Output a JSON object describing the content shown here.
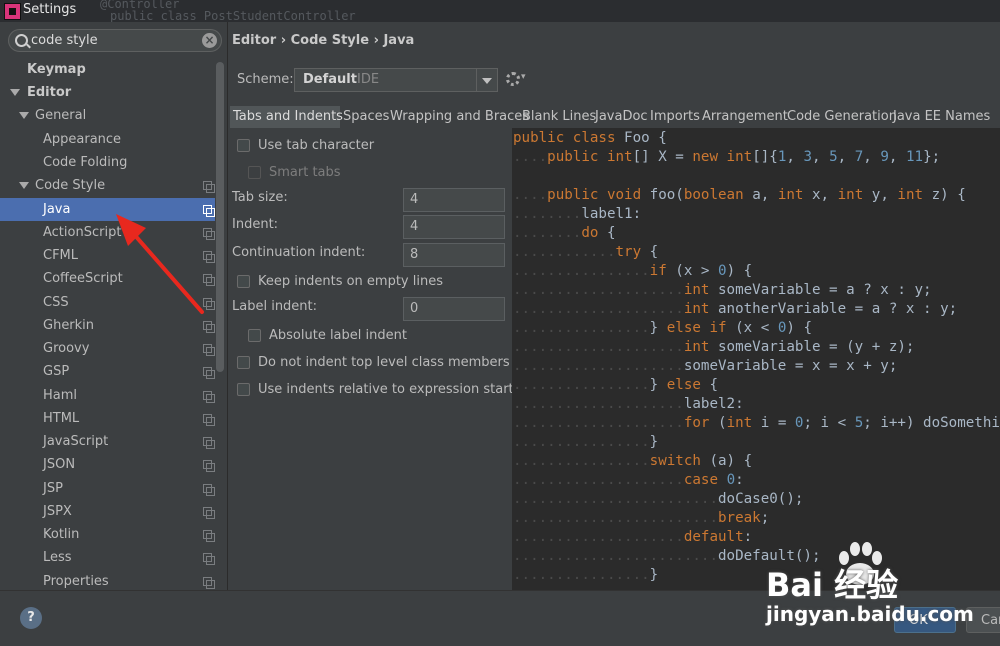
{
  "window": {
    "title": "Settings",
    "background_code": [
      "@Controller",
      "public class PostStudentController"
    ]
  },
  "search": {
    "value": "code style"
  },
  "tree": {
    "keymap": "Keymap",
    "editor": "Editor",
    "general": "General",
    "appearance": "Appearance",
    "code_folding": "Code Folding",
    "code_style": "Code Style",
    "languages": [
      "Java",
      "ActionScript",
      "CFML",
      "CoffeeScript",
      "CSS",
      "Gherkin",
      "Groovy",
      "GSP",
      "Haml",
      "HTML",
      "JavaScript",
      "JSON",
      "JSP",
      "JSPX",
      "Kotlin",
      "Less",
      "Properties"
    ],
    "selected": "Java"
  },
  "breadcrumb": "Editor › Code Style › Java",
  "scheme": {
    "label": "Scheme:",
    "value": "Default",
    "sub": "IDE"
  },
  "tabs": [
    "Tabs and Indents",
    "Spaces",
    "Wrapping and Braces",
    "Blank Lines",
    "JavaDoc",
    "Imports",
    "Arrangement",
    "Code Generation",
    "Java EE Names"
  ],
  "options": {
    "use_tab": "Use tab character",
    "smart_tabs": "Smart tabs",
    "tab_size_label": "Tab size:",
    "tab_size": "4",
    "indent_label": "Indent:",
    "indent": "4",
    "continuation_label": "Continuation indent:",
    "continuation": "8",
    "keep_indents": "Keep indents on empty lines",
    "label_indent_label": "Label indent:",
    "label_indent": "0",
    "absolute_label": "Absolute label indent",
    "no_indent_top": "Do not indent top level class members",
    "relative_indents": "Use indents relative to expression start"
  },
  "buttons": {
    "help": "?",
    "ok": "OK",
    "cancel": "Cancel"
  },
  "watermark": {
    "brand": "Bai  经验",
    "url": "jingyan.baidu.com"
  },
  "colors": {
    "selection": "#4b6eaf",
    "keyword": "#cc7832",
    "number": "#6897bb",
    "text": "#a9b7c6",
    "arrow": "#e8281e"
  }
}
